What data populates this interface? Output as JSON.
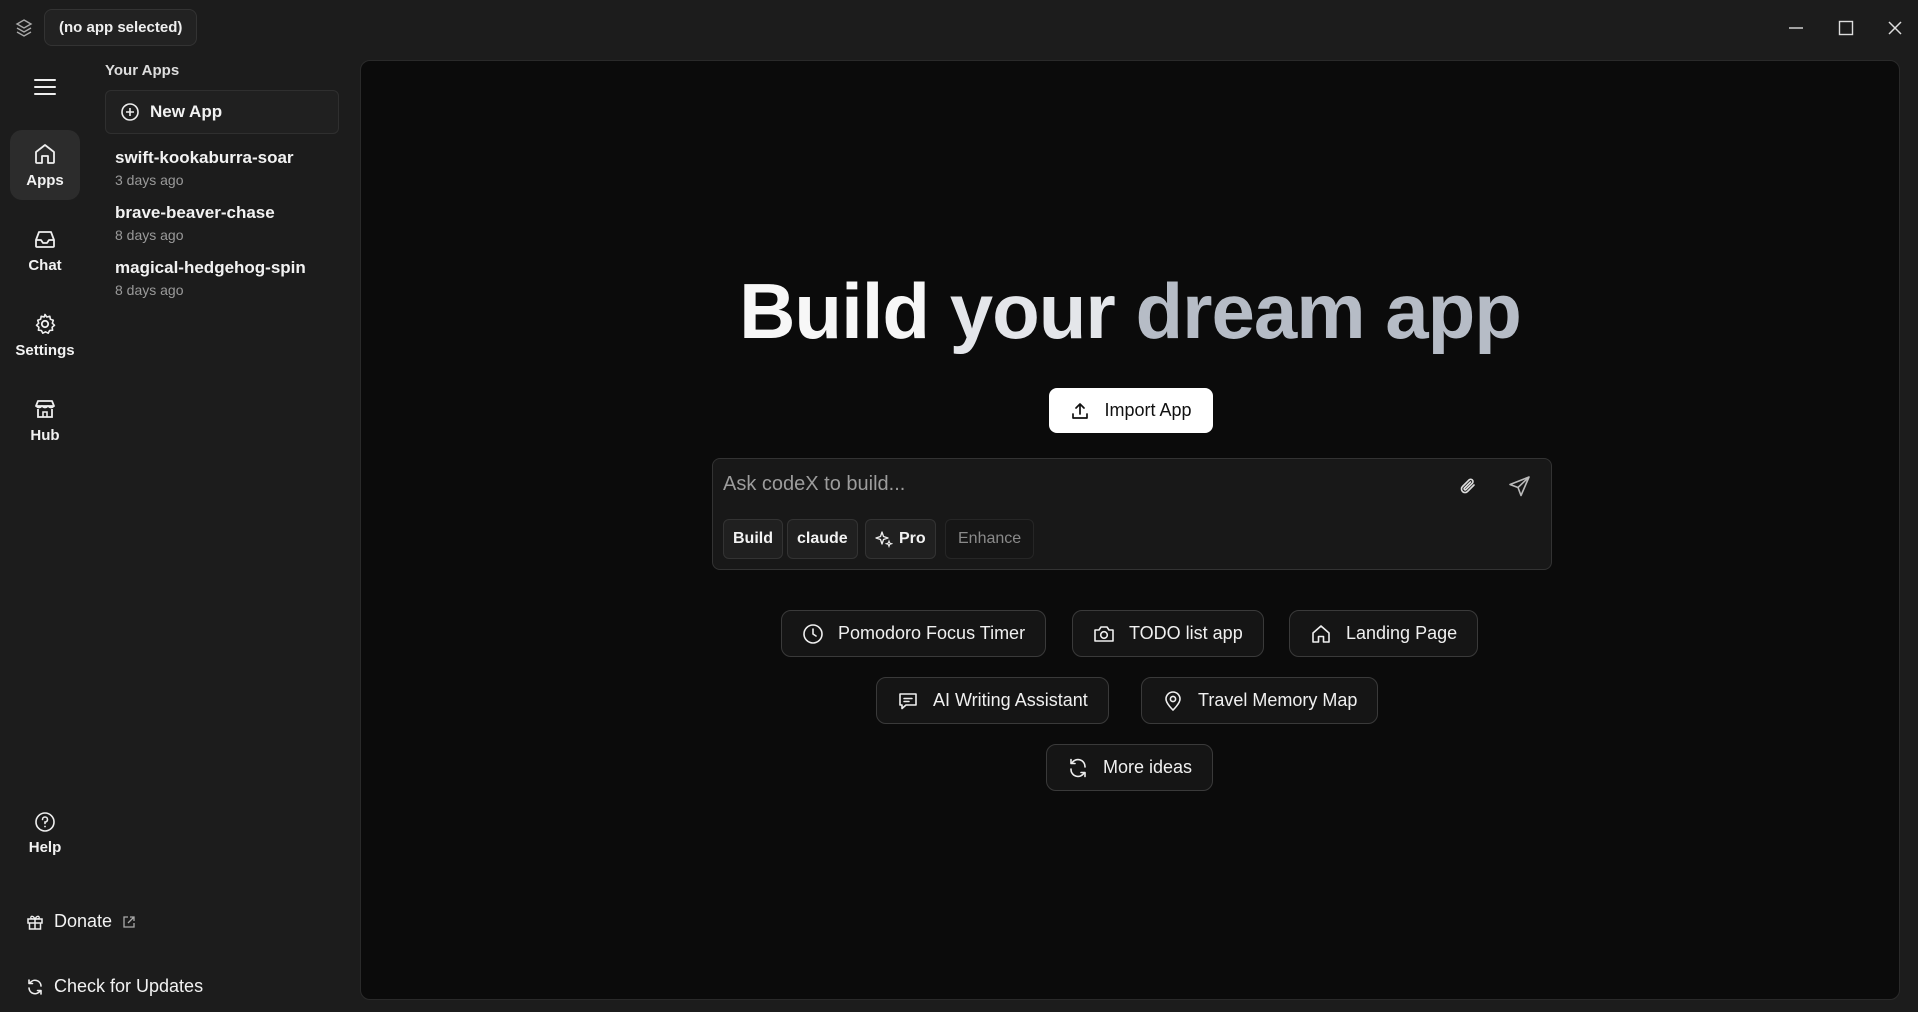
{
  "titlebar": {
    "app_pill": "(no app selected)"
  },
  "rail": {
    "items": [
      {
        "label": "Apps"
      },
      {
        "label": "Chat"
      },
      {
        "label": "Settings"
      },
      {
        "label": "Hub"
      },
      {
        "label": "Help"
      }
    ]
  },
  "panel": {
    "title": "Your Apps",
    "new_app_label": "New App",
    "apps": [
      {
        "name": "swift-kookaburra-soar",
        "time": "3 days ago"
      },
      {
        "name": "brave-beaver-chase",
        "time": "8 days ago"
      },
      {
        "name": "magical-hedgehog-spin",
        "time": "8 days ago"
      }
    ],
    "donate_label": "Donate",
    "updates_label": "Check for Updates"
  },
  "main": {
    "hero": {
      "w1": "Build",
      "w2": "your",
      "w3": "dream app"
    },
    "import_label": "Import App",
    "chat": {
      "placeholder": "Ask codeX to build...",
      "chips": {
        "build": "Build",
        "model": "claude",
        "pro": "Pro",
        "enhance": "Enhance"
      }
    },
    "ideas": [
      {
        "label": "Pomodoro Focus Timer",
        "icon": "clock-icon"
      },
      {
        "label": "TODO list app",
        "icon": "camera-icon"
      },
      {
        "label": "Landing Page",
        "icon": "home-icon"
      },
      {
        "label": "AI Writing Assistant",
        "icon": "message-icon"
      },
      {
        "label": "Travel Memory Map",
        "icon": "map-pin-icon"
      },
      {
        "label": "More ideas",
        "icon": "refresh-icon"
      }
    ]
  },
  "colors": {
    "background": "#1c1c1c",
    "main_bg": "#0b0b0b",
    "accent_button": "#ffffff"
  }
}
